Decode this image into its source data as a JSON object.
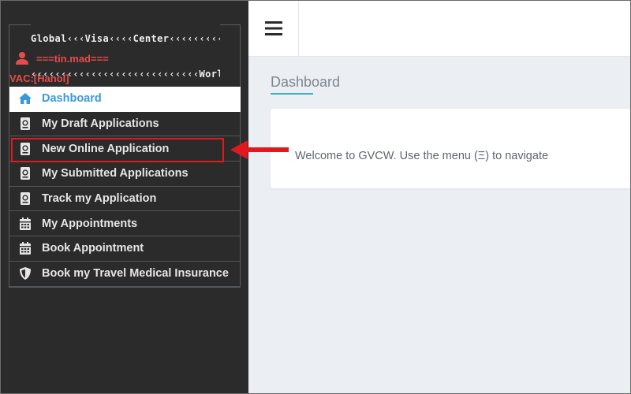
{
  "brand": {
    "line1": "Global‹‹‹Visa‹‹‹‹Center‹‹‹‹‹‹‹‹‹",
    "line2": "‹‹‹‹‹‹‹‹‹‹‹‹‹‹‹‹‹‹‹‹‹‹‹‹‹‹‹‹World"
  },
  "user": {
    "name": "===tin.mad===",
    "icon": "user-icon"
  },
  "vac_label": "VAC:[Hanoi]",
  "menu": [
    {
      "label": "Dashboard",
      "icon": "home-icon",
      "active": true
    },
    {
      "label": "My Draft Applications",
      "icon": "passport-icon"
    },
    {
      "label": "New Online Application",
      "icon": "passport-icon",
      "highlighted": true
    },
    {
      "label": "My Submitted Applications",
      "icon": "passport-icon"
    },
    {
      "label": "Track my Application",
      "icon": "passport-icon"
    },
    {
      "label": "My Appointments",
      "icon": "calendar-icon"
    },
    {
      "label": "Book Appointment",
      "icon": "calendar-icon"
    },
    {
      "label": "Book my Travel Medical Insurance",
      "icon": "shield-icon"
    }
  ],
  "topbar": {
    "menu_icon": "hamburger-icon"
  },
  "main": {
    "title": "Dashboard",
    "welcome": "Welcome to GVCW. Use the menu (Ξ) to navigate"
  },
  "colors": {
    "sidebar_bg": "#2b2b2b",
    "accent": "#3a9ad9",
    "user_red": "#e74c4c",
    "annotation_red": "#e3181e",
    "title_underline": "#39b1c6"
  }
}
